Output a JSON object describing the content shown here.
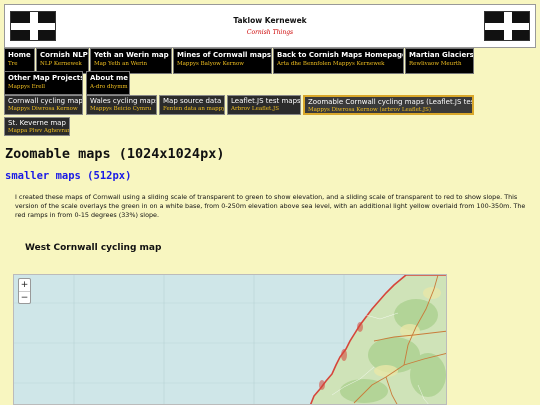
{
  "header": {
    "title": "Taklow Kernewek",
    "subtitle": "Cornish Things",
    "flag_icon": "cornish-flag"
  },
  "nav": [
    {
      "en": "Home",
      "kw": "Tre"
    },
    {
      "en": "Cornish NLP",
      "kw": "NLP Kernewek"
    },
    {
      "en": "Yeth an Werin map",
      "kw": "Map Yeth an Werin"
    },
    {
      "en": "Mines of Cornwall maps",
      "kw": "Mappys Balyow Kernow"
    },
    {
      "en": "Back to Cornish Maps Homepage",
      "kw": "Arta dhe Bennfolen Mappys Kernewek"
    },
    {
      "en": "Martian Glaciers",
      "kw": "Rewlivaow Meurth"
    },
    {
      "en": "Other Map Projects",
      "kw": "Mappys Erell"
    },
    {
      "en": "About me",
      "kw": "A-dro dhymm"
    }
  ],
  "subnav": [
    {
      "en": "Cornwall cycling maps",
      "kw": "Mappys Diwrosa Kernow",
      "active": false
    },
    {
      "en": "Wales cycling maps",
      "kw": "Mappys Beicio Cymru",
      "active": false
    },
    {
      "en": "Map source data",
      "kw": "Fenten data an mappys",
      "active": false
    },
    {
      "en": "Leaflet.JS test maps",
      "kw": "Arbrov Leaflet.JS",
      "active": false
    },
    {
      "en": "Zoomable Cornwall cycling maps (Leaflet.JS test)",
      "kw": "Mappys Diwrosa Kernow (arbrov Leaflet.JS)",
      "active": true
    },
    {
      "en": "St. Keverne map",
      "kw": "Mappa Plwv Aghevran",
      "active": false
    }
  ],
  "main": {
    "title": "Zoomable maps (1024x1024px)",
    "small_link": "smaller maps (512px)",
    "description": "I created these maps of Cornwall using a sliding scale of transparent to green to show elevation, and a sliding scale of transparent to red to show slope. This version of the scale overlays the green in on a white base, from 0-250m elevation above sea level, with an additional light yellow overlaid from 100-350m. The red ramps in from 0-15 degrees (33%) slope.",
    "map_heading": "West Cornwall cycling map"
  },
  "map": {
    "zoom_in": "+",
    "zoom_out": "−",
    "sea_color": "#cfe6e8",
    "land_color": "#cfe3b8",
    "slope_color": "#d6453a"
  }
}
